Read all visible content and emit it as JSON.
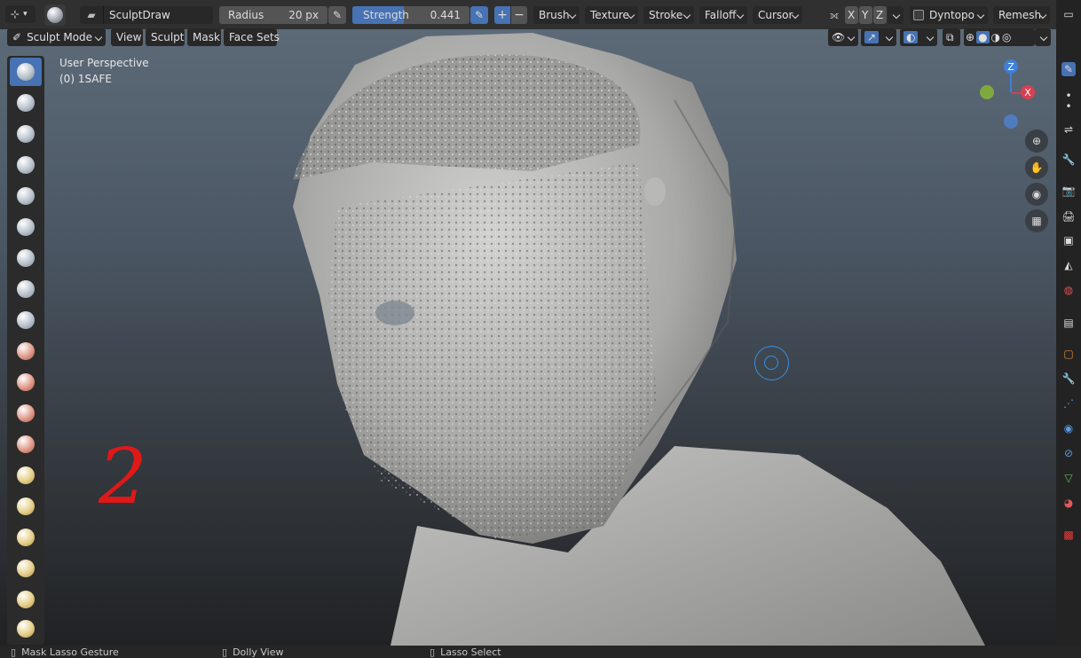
{
  "topbar": {
    "brush_name": "SculptDraw",
    "radius_label": "Radius",
    "radius_value": "20 px",
    "strength_label": "Strength",
    "strength_value": "0.441",
    "strength_fraction": 0.441,
    "menus": [
      "Brush",
      "Texture",
      "Stroke",
      "Falloff",
      "Cursor"
    ],
    "axes": [
      "X",
      "Y",
      "Z"
    ],
    "dyntopo": "Dyntopo",
    "remesh": "Remesh"
  },
  "header": {
    "mode": "Sculpt Mode",
    "menus": [
      "View",
      "Sculpt",
      "Mask",
      "Face Sets"
    ]
  },
  "viewport": {
    "perspective": "User Perspective",
    "object": "(0) 1SAFE",
    "annotation": "2",
    "gizmo": {
      "z": "Z",
      "x": "X"
    }
  },
  "tools": [
    "draw",
    "draw-sharp",
    "clay",
    "clay-strips",
    "clay-thumb",
    "layer",
    "inflate",
    "blob",
    "crease",
    "smooth",
    "flatten",
    "fill",
    "scrape",
    "multiplane-scrape",
    "pinch",
    "grab",
    "elastic-deform",
    "snake-hook",
    "thumb"
  ],
  "statusbar": {
    "items": [
      "Mask Lasso Gesture",
      "Dolly View",
      "Lasso Select"
    ]
  },
  "colors": {
    "accent": "#4772b3",
    "annotation": "#e01818"
  }
}
